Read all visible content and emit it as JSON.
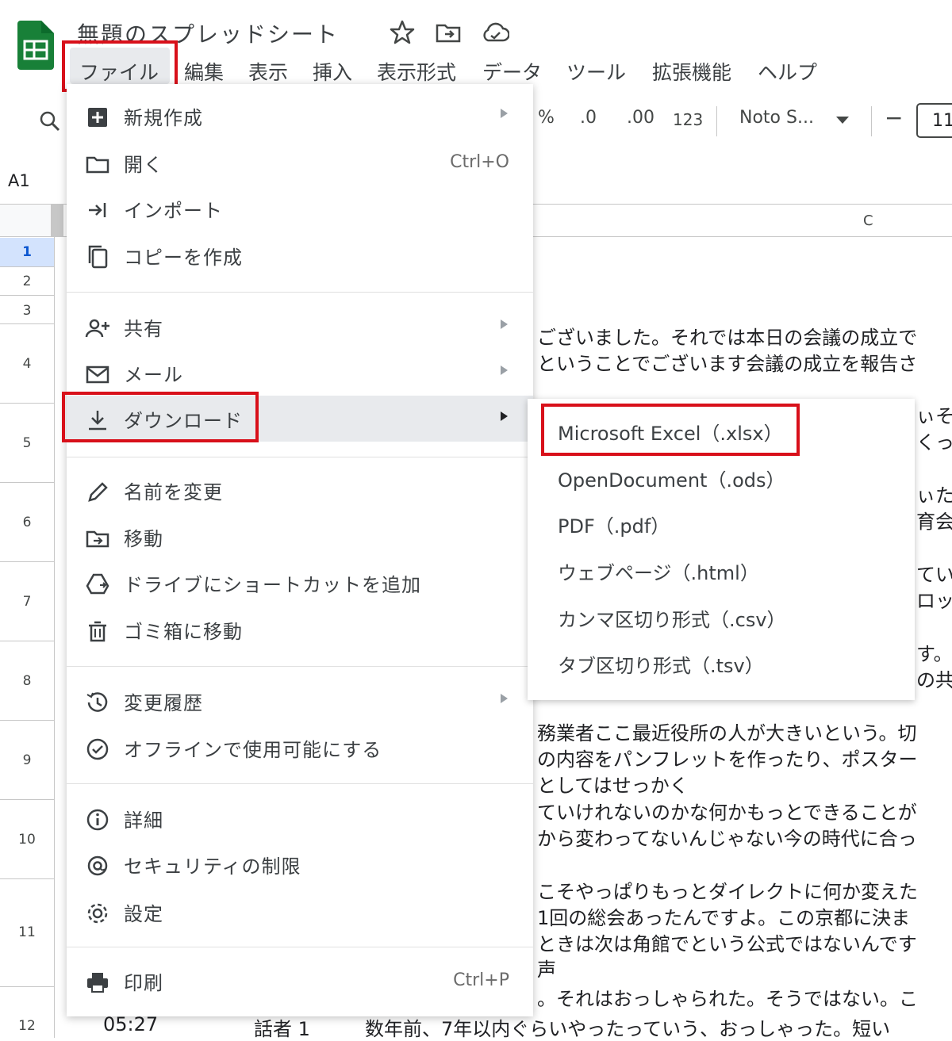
{
  "app": {
    "title": "無題のスプレッドシート",
    "title_icons": [
      "star-icon",
      "move-folder-icon",
      "cloud-status-icon"
    ],
    "accent_color": "#188038",
    "highlight_color": "#d8101a"
  },
  "menubar": {
    "file": "ファイル",
    "edit": "編集",
    "view": "表示",
    "insert": "挿入",
    "format": "表示形式",
    "data": "データ",
    "tools": "ツール",
    "extensions": "拡張機能",
    "help": "ヘルプ"
  },
  "toolbar": {
    "percent": "%",
    "decrease_decimal": ".0",
    "increase_decimal": ".00",
    "number_format": "123",
    "font": "Noto S...",
    "minus": "−",
    "font_size": "11"
  },
  "sheet": {
    "name_box": "A1",
    "column_c": "C",
    "row_numbers": [
      "1",
      "2",
      "3",
      "4",
      "5",
      "6",
      "7",
      "8",
      "9",
      "10",
      "11",
      "12"
    ],
    "cell_lines": [
      "ございました。それでは本日の会議の成立で",
      "ということでございます会議の成立を報告さ",
      "ぃそ",
      "くっ",
      "ぃた",
      "育会",
      "てい",
      "ロッ",
      "す。",
      "の共",
      "務業者ここ最近役所の人が大きいという。切",
      "の内容をパンフレットを作ったり、ポスター",
      "としてはせっかく",
      "ていけれないのかな何かもっとできることが",
      "から変わってないんじゃない今の時代に合っ",
      "こそやっぱりもっとダイレクトに何か変えた",
      "1回の総会あったんですよ。この京都に決ま",
      "ときは次は角館でという公式ではないんです",
      "声",
      "。それはおっしゃられた。そうではない。こ"
    ],
    "row12": {
      "time": "05:27",
      "speaker": "話者 1",
      "text": "数年前、7年以内ぐらいやったっていう、おっしゃった。短い"
    }
  },
  "file_menu": {
    "new": "新規作成",
    "open": "開く",
    "open_shortcut": "Ctrl+O",
    "import": "インポート",
    "copy": "コピーを作成",
    "share": "共有",
    "email": "メール",
    "download": "ダウンロード",
    "rename": "名前を変更",
    "move": "移動",
    "shortcut": "ドライブにショートカットを追加",
    "trash": "ゴミ箱に移動",
    "history": "変更履歴",
    "offline": "オフラインで使用可能にする",
    "details": "詳細",
    "security": "セキュリティの制限",
    "settings": "設定",
    "print": "印刷",
    "print_shortcut": "Ctrl+P"
  },
  "download_menu": {
    "xlsx": "Microsoft Excel（.xlsx）",
    "ods": "OpenDocument（.ods）",
    "pdf": "PDF（.pdf）",
    "html": "ウェブページ（.html）",
    "csv": "カンマ区切り形式（.csv）",
    "tsv": "タブ区切り形式（.tsv）"
  }
}
